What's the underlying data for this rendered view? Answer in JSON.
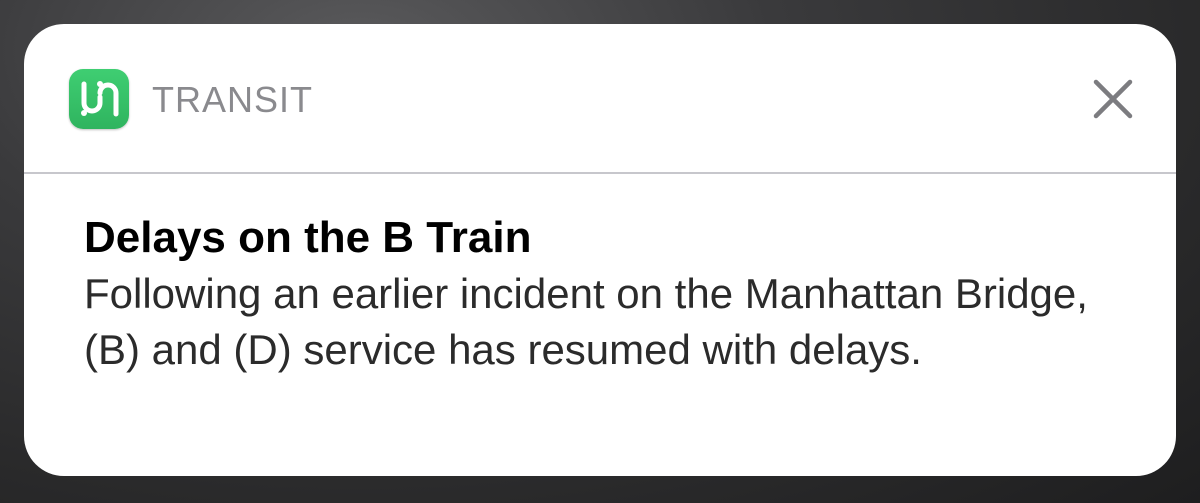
{
  "notification": {
    "app": {
      "name": "TRANSIT",
      "icon": "transit-app-icon",
      "icon_color": "#35c064"
    },
    "close_icon": "close-icon",
    "title": "Delays on the B Train",
    "message": "Following an earlier incident on the Manhattan Bridge,  (B)  and  (D)  service has resumed with delays."
  }
}
